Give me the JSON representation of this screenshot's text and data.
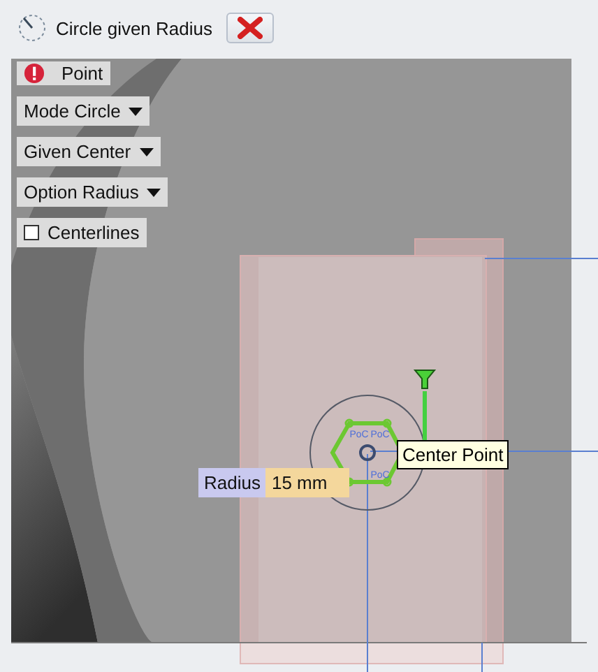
{
  "window": {
    "title": "Circle given Radius"
  },
  "panel": [
    {
      "kind": "status",
      "label": "Point"
    },
    {
      "kind": "dropdown",
      "label": "Mode Circle"
    },
    {
      "kind": "dropdown",
      "label": "Given Center"
    },
    {
      "kind": "dropdown",
      "label": "Option Radius"
    },
    {
      "kind": "checkbox",
      "label": "Centerlines",
      "checked": false
    }
  ],
  "canvas": {
    "constraint_labels": [
      "PoC",
      "PoC",
      "PoC"
    ],
    "tooltip": "Center Point",
    "dimension": {
      "label": "Radius",
      "value": "15 mm"
    }
  }
}
